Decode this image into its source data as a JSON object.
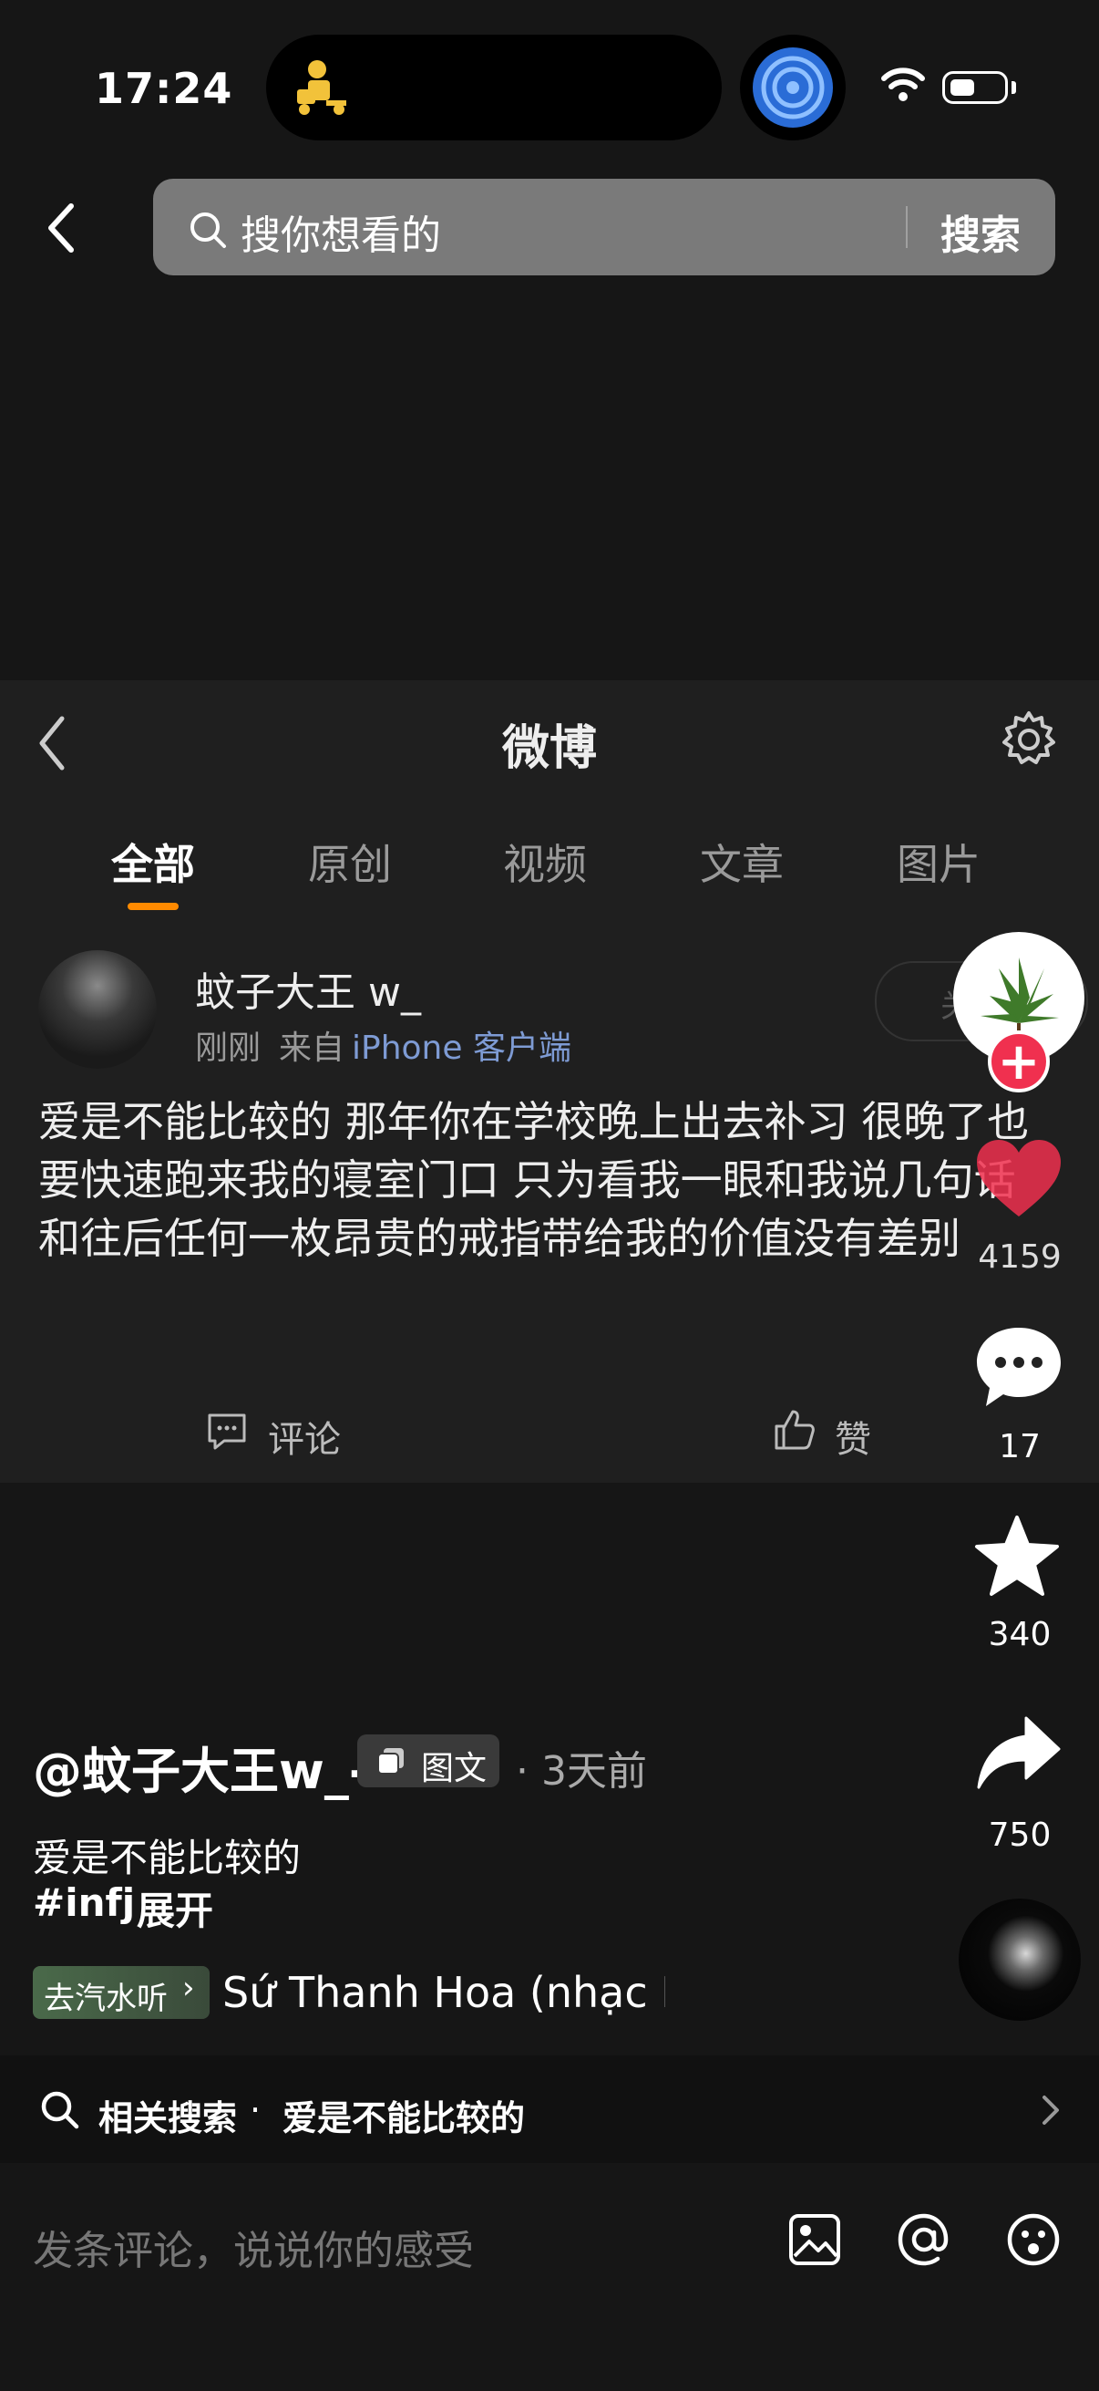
{
  "status_bar": {
    "time": "17:24"
  },
  "search": {
    "placeholder": "搜你想看的",
    "button": "搜索"
  },
  "weibo": {
    "title": "微博",
    "tabs": [
      "全部",
      "原创",
      "视频",
      "文章",
      "图片"
    ],
    "post": {
      "username": "蚊子大王 w_",
      "time": "刚刚",
      "from": "来自",
      "client": "iPhone 客户端",
      "text": "爱是不能比较的 那年你在学校晚上出去补习 很晚了也要快速跑来我的寝室门口 只为看我一眼和我说几句话 和往后任何一枚昂贵的戒指带给我的价值没有差别",
      "comment_label": "评论",
      "like_label": "赞",
      "follow_label": "关"
    }
  },
  "actions": {
    "likes": "4159",
    "comments": "17",
    "favorites": "340",
    "shares": "750"
  },
  "post_info": {
    "author": "@蚊子大王w_-",
    "type_badge": "图文",
    "time": "· 3天前",
    "caption": "爱是不能比较的",
    "tag": "#infj",
    "expand": "展开",
    "music_badge": "去汽水听",
    "song": "Sứ Thanh Hoa (nhạc Hoa)"
  },
  "related": {
    "label": "相关搜索",
    "dot": "·",
    "query": "爱是不能比较的"
  },
  "comment_input": {
    "placeholder": "发条评论，说说你的感受"
  },
  "colors": {
    "accent_orange": "#ff8a00",
    "like_red": "#f0304f",
    "link_blue": "#7e9bd4"
  }
}
